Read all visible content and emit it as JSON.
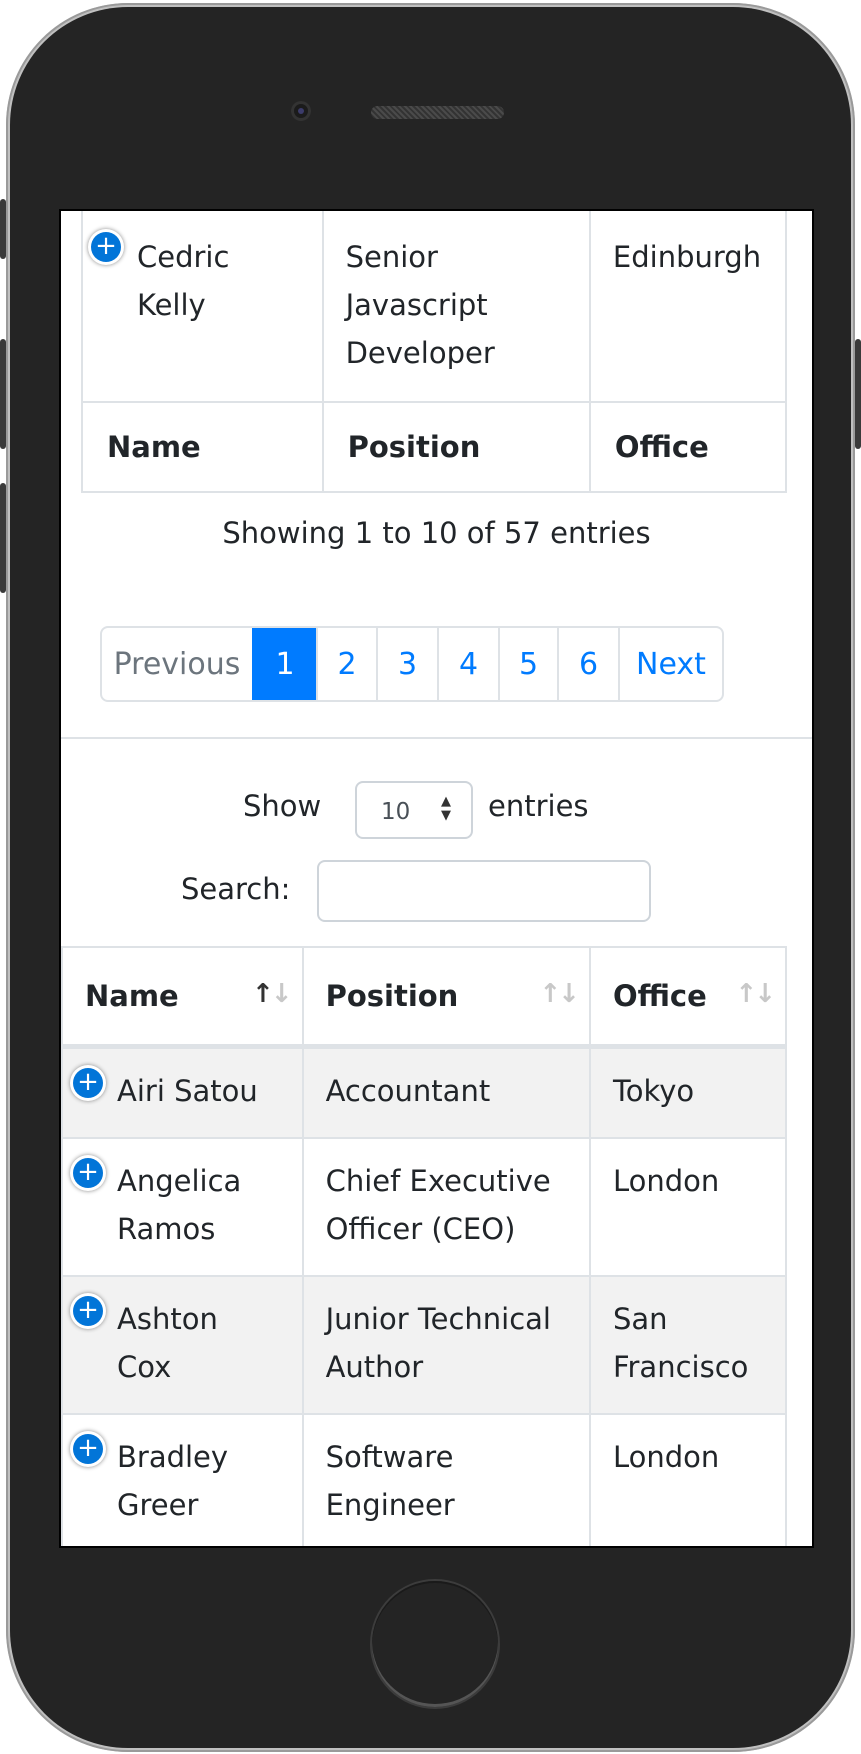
{
  "top_table": {
    "row": {
      "name": "Cedric Kelly",
      "position": "Senior Javascript Developer",
      "office": "Edinburgh"
    },
    "footer": {
      "name": "Name",
      "position": "Position",
      "office": "Office"
    }
  },
  "info_text": "Showing 1 to 10 of 57 entries",
  "pagination": {
    "previous": "Previous",
    "pages": [
      "1",
      "2",
      "3",
      "4",
      "5",
      "6"
    ],
    "active_page": "1",
    "next": "Next"
  },
  "length_control": {
    "show": "Show",
    "value": "10",
    "entries": "entries"
  },
  "search": {
    "label": "Search:",
    "value": ""
  },
  "main_table": {
    "headers": {
      "name": "Name",
      "position": "Position",
      "office": "Office"
    },
    "rows": [
      {
        "name": "Airi Satou",
        "position": "Accountant",
        "office": "Tokyo"
      },
      {
        "name": "Angelica Ramos",
        "position": "Chief Executive Officer (CEO)",
        "office": "London"
      },
      {
        "name": "Ashton Cox",
        "position": "Junior Technical Author",
        "office": "San Francisco"
      },
      {
        "name": "Bradley Greer",
        "position": "Software Engineer",
        "office": "London"
      }
    ]
  },
  "colors": {
    "accent": "#007bff",
    "expand_icon": "#0275d8",
    "stripe": "#f2f2f2",
    "border": "#dee2e6"
  },
  "icons": {
    "expand": "plus-circle-icon",
    "sort": "sort-arrows-icon"
  }
}
